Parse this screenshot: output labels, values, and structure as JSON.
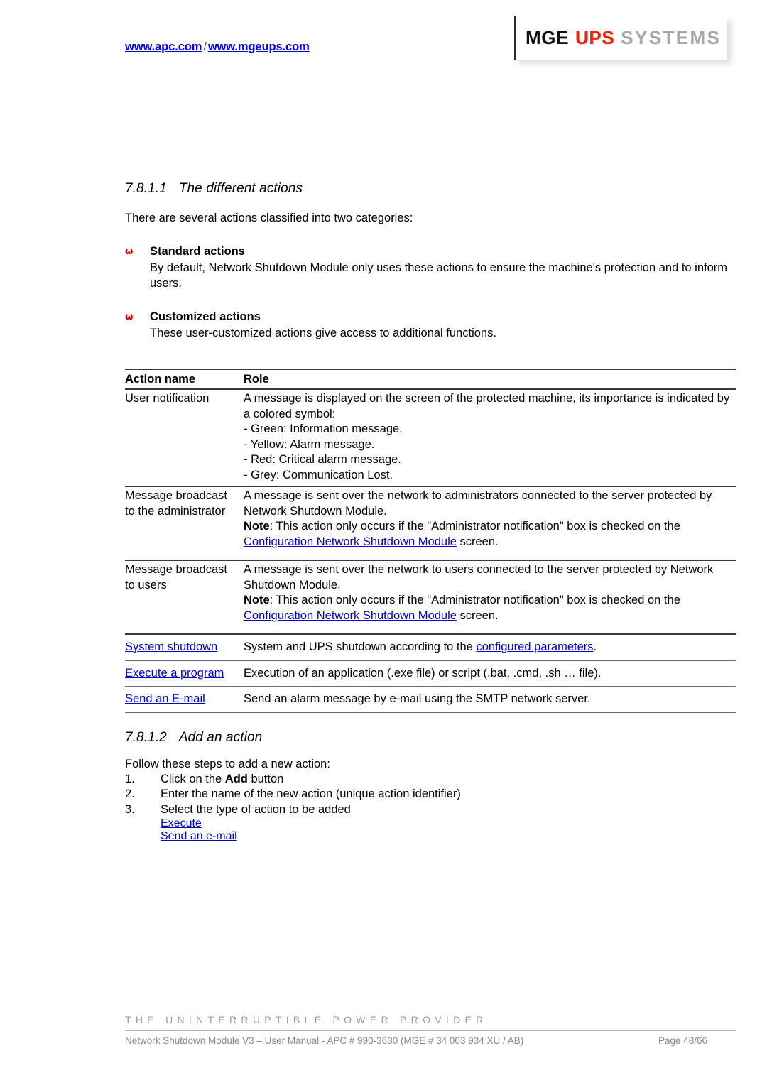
{
  "header": {
    "link_apc": "www.apc.com",
    "separator": "/",
    "link_mge": "www.mgeups.com",
    "logo": {
      "part1": "MGE",
      "part2": "UPS",
      "part3": "SYSTEMS",
      "color_part1": "#111111",
      "color_part2": "#ff1a00",
      "color_part3": "#a6a6a6"
    }
  },
  "sections": {
    "different_actions": {
      "number": "7.8.1.1",
      "title": "The different actions",
      "intro": "There are several actions classified into two categories:",
      "bullet_glyph": "ω",
      "bullets": [
        {
          "title": "Standard actions",
          "body": "By default, Network Shutdown Module only uses these actions to ensure the machine's protection and to inform users."
        },
        {
          "title": "Customized actions",
          "body": "These user-customized actions give access to additional functions."
        }
      ]
    },
    "add_an_action": {
      "number": "7.8.1.2",
      "title": "Add an action",
      "intro": "Follow these steps to add a new action:",
      "steps": [
        {
          "num": "1.",
          "text_before": "Click on the ",
          "bold": "Add",
          "text_after": " button"
        },
        {
          "num": "2.",
          "text_before": "Enter the name of the new action (unique action identifier)",
          "bold": "",
          "text_after": ""
        },
        {
          "num": "3.",
          "text_before": "Select the type of action to be added",
          "bold": "",
          "text_after": ""
        }
      ],
      "sub_links": [
        "Execute",
        "Send an e-mail"
      ]
    }
  },
  "table": {
    "headers": [
      "Action name",
      "Role"
    ],
    "rows": [
      {
        "name": "User notification",
        "role_lines": [
          "A message is displayed on the screen of the protected machine, its importance is indicated by a colored symbol:",
          "- Green: Information message.",
          "- Yellow: Alarm message.",
          "- Red: Critical alarm message.",
          "- Grey: Communication Lost."
        ]
      },
      {
        "name": "Message broadcast to the administrator",
        "role_main": "A message is sent over the network to administrators connected to the server protected by Network Shutdown Module.",
        "note_label": "Note",
        "note_text": ": This action only occurs if the \"Administrator notification\" box is checked on the ",
        "note_link": "Configuration Network Shutdown Module",
        "note_tail": " screen."
      },
      {
        "name": "Message broadcast to users",
        "role_main": "A message is sent over the network to users connected to the server protected by Network Shutdown Module.",
        "note_label": "Note",
        "note_text": ": This action only occurs if the \"Administrator notification\" box is checked on the ",
        "note_link": "Configuration Network Shutdown Module",
        "note_tail": " screen."
      },
      {
        "name_link": "System shutdown",
        "role_before": "System and UPS shutdown according to the ",
        "role_link": "configured parameters",
        "role_after": "."
      },
      {
        "name_link": "Execute a program",
        "role_before": "Execution of an application (.exe file) or script (.bat, .cmd, .sh … file).",
        "role_link": "",
        "role_after": ""
      },
      {
        "name_link": "Send an E-mail",
        "role_before": "Send an alarm message by e-mail using the SMTP network server.",
        "role_link": "",
        "role_after": ""
      }
    ]
  },
  "footer": {
    "tagline": "THE UNINTERRUPTIBLE POWER PROVIDER",
    "doc_line": "Network Shutdown Module V3 – User Manual - APC # 990-3630 (MGE # 34 003 934 XU / AB)",
    "page_label": "Page 48/66"
  }
}
